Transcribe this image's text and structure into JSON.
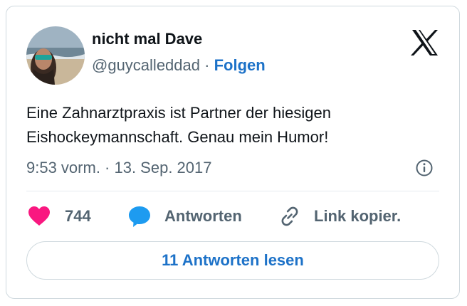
{
  "author": {
    "name": "nicht mal Dave",
    "handle": "@guycalleddad",
    "separator": "·",
    "follow_label": "Folgen"
  },
  "tweet": {
    "text_lines": [
      "Eine Zahnarztpraxis ist Partner der hiesigen",
      "Eishockeymannschaft. Genau mein Humor!"
    ],
    "timestamp": "9:53 vorm. · 13. Sep. 2017"
  },
  "actions": {
    "like_count": "744",
    "reply_label": "Antworten",
    "copy_link_label": "Link kopier."
  },
  "read_replies_label": "11 Antworten lesen",
  "icons": {
    "brand": "x-logo-icon",
    "info": "info-icon",
    "like": "heart-icon",
    "reply": "speech-bubble-icon",
    "copy_link": "link-icon"
  },
  "colors": {
    "link_blue": "#1d72c8",
    "heart_pink": "#f91880",
    "reply_blue": "#1d9bf0",
    "muted_text": "#536471",
    "border": "#cfd9de"
  }
}
